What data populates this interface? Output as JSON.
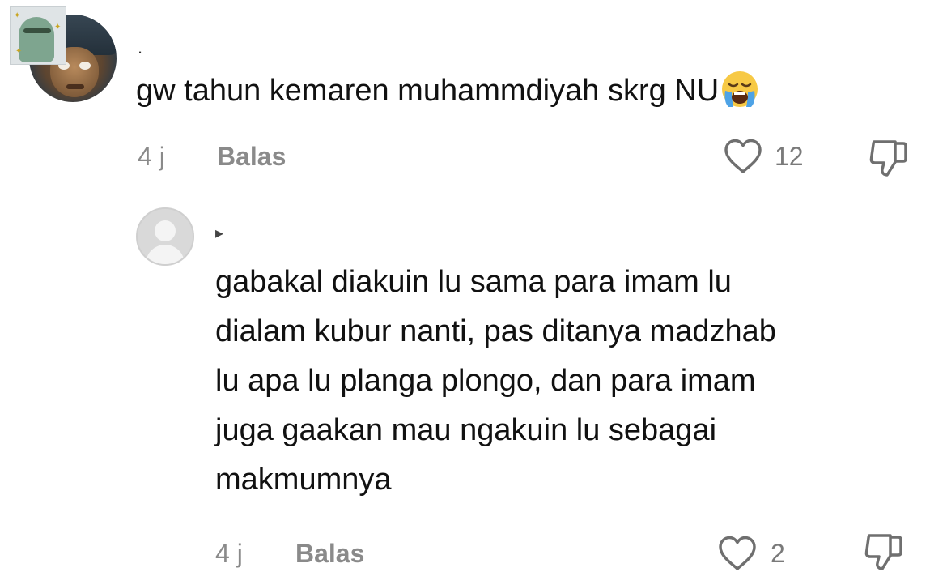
{
  "comments": [
    {
      "username": ".",
      "text": "gw tahun kemaren muhammdiyah skrg NU",
      "emoji": "loudly-crying-face",
      "time": "4 j",
      "reply_label": "Balas",
      "likes": "12"
    },
    {
      "username": "▸",
      "text_lines": [
        "gabakal diakuin lu sama para imam lu",
        "dialam kubur nanti, pas ditanya madzhab",
        "lu apa lu planga plongo, dan para imam",
        "juga gaakan mau ngakuin lu sebagai",
        "makmumnya"
      ],
      "time": "4 j",
      "reply_label": "Balas",
      "likes": "2"
    }
  ],
  "icons": {
    "like": "heart-outline-icon",
    "dislike": "thumbs-down-outline-icon"
  },
  "colors": {
    "text": "#111111",
    "meta": "#8a8a8a",
    "icon_stroke": "#6f6f6f",
    "avatar_placeholder": "#d9d9d9"
  }
}
